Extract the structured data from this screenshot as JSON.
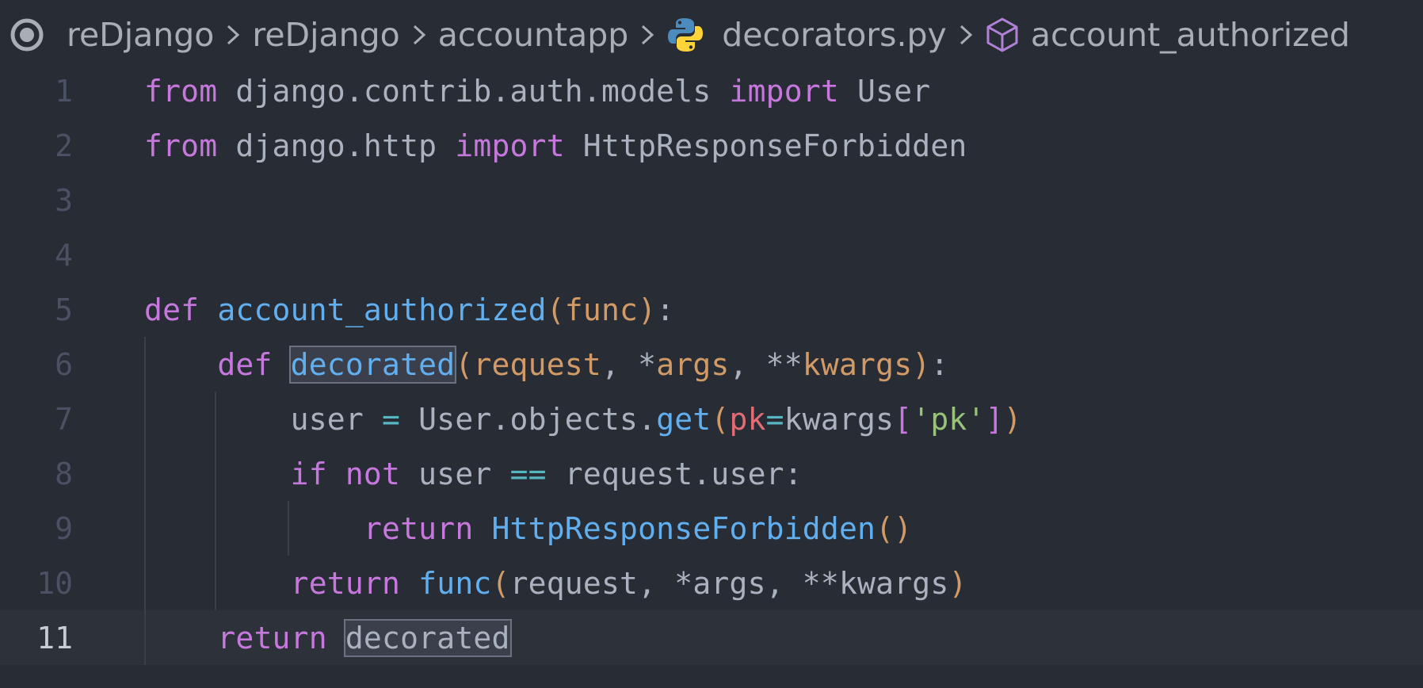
{
  "breadcrumb": {
    "items": [
      "reDjango",
      "reDjango",
      "accountapp",
      "decorators.py",
      "account_authorized"
    ],
    "separator": ">",
    "lead_icon": "circle-dot-icon",
    "file_icon": "python-icon",
    "symbol_icon": "cube-icon"
  },
  "editor": {
    "active_line": 11,
    "line_numbers": [
      "1",
      "2",
      "3",
      "4",
      "5",
      "6",
      "7",
      "8",
      "9",
      "10",
      "11"
    ],
    "lines": [
      [
        [
          "kw",
          "from"
        ],
        [
          "plain",
          " django.contrib.auth.models "
        ],
        [
          "kw",
          "import"
        ],
        [
          "plain",
          " User"
        ]
      ],
      [
        [
          "kw",
          "from"
        ],
        [
          "plain",
          " django.http "
        ],
        [
          "kw",
          "import"
        ],
        [
          "plain",
          " HttpResponseForbidden"
        ]
      ],
      [],
      [],
      [
        [
          "kw",
          "def"
        ],
        [
          "plain",
          " "
        ],
        [
          "fn",
          "account_authorized"
        ],
        [
          "paren",
          "("
        ],
        [
          "param",
          "func"
        ],
        [
          "paren",
          ")"
        ],
        [
          "plain",
          ":"
        ]
      ],
      [
        [
          "plain",
          "    "
        ],
        [
          "kw",
          "def"
        ],
        [
          "plain",
          " "
        ],
        [
          "fn-hl",
          "decorated"
        ],
        [
          "paren",
          "("
        ],
        [
          "param",
          "request"
        ],
        [
          "plain",
          ", "
        ],
        [
          "plain",
          "*"
        ],
        [
          "param",
          "args"
        ],
        [
          "plain",
          ", "
        ],
        [
          "plain",
          "**"
        ],
        [
          "param",
          "kwargs"
        ],
        [
          "paren",
          ")"
        ],
        [
          "plain",
          ":"
        ]
      ],
      [
        [
          "plain",
          "        user "
        ],
        [
          "op",
          "="
        ],
        [
          "plain",
          " User.objects."
        ],
        [
          "fn",
          "get"
        ],
        [
          "paren",
          "("
        ],
        [
          "arg",
          "pk"
        ],
        [
          "op",
          "="
        ],
        [
          "plain",
          "kwargs"
        ],
        [
          "bracket",
          "["
        ],
        [
          "str",
          "'pk'"
        ],
        [
          "bracket",
          "]"
        ],
        [
          "paren",
          ")"
        ]
      ],
      [
        [
          "plain",
          "        "
        ],
        [
          "kw",
          "if"
        ],
        [
          "plain",
          " "
        ],
        [
          "kw",
          "not"
        ],
        [
          "plain",
          " user "
        ],
        [
          "op",
          "=="
        ],
        [
          "plain",
          " request.user:"
        ]
      ],
      [
        [
          "plain",
          "            "
        ],
        [
          "kw",
          "return"
        ],
        [
          "plain",
          " "
        ],
        [
          "fn",
          "HttpResponseForbidden"
        ],
        [
          "paren",
          "()"
        ]
      ],
      [
        [
          "plain",
          "        "
        ],
        [
          "kw",
          "return"
        ],
        [
          "plain",
          " "
        ],
        [
          "fn",
          "func"
        ],
        [
          "paren",
          "("
        ],
        [
          "plain",
          "request, *args, **kwargs"
        ],
        [
          "paren",
          ")"
        ]
      ],
      [
        [
          "plain",
          "    "
        ],
        [
          "kw",
          "return"
        ],
        [
          "plain",
          " "
        ],
        [
          "plain-hl",
          "decorated"
        ]
      ]
    ]
  },
  "colors": {
    "background": "#282c34",
    "keyword": "#c678dd",
    "function": "#61afef",
    "parameter": "#d19a66",
    "string": "#98c379",
    "operator": "#56b6c2",
    "text": "#abb2bf",
    "python_blue": "#3572a5",
    "python_yellow": "#ffd43b"
  }
}
